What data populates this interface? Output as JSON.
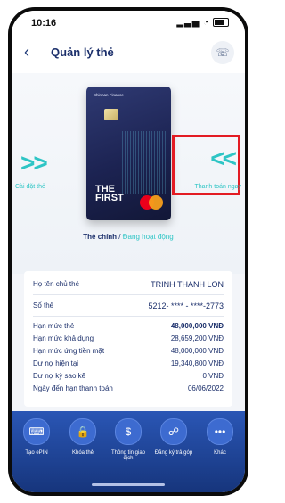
{
  "status_bar": {
    "time": "10:16",
    "signal": "..ll",
    "wifi": "wifi"
  },
  "header": {
    "back_icon": "chevron-left-icon",
    "title": "Quản lý thẻ",
    "support_icon": "phone-icon"
  },
  "carousel": {
    "left_label": "Cài đặt thẻ",
    "right_label": "Thanh toán ngay",
    "card": {
      "brand": "Shinhan Finance",
      "name_line1": "THE",
      "name_line2": "FIRST",
      "network": "mastercard"
    },
    "card_type": "Thẻ chính",
    "separator": "/",
    "card_state": "Đang hoạt động"
  },
  "info": {
    "rows": [
      {
        "label": "Họ tên chủ thẻ",
        "value": "TRINH THANH LON"
      },
      {
        "label": "Số thẻ",
        "value": "5212- **** - ****-2773"
      },
      {
        "label": "Hạn mức thẻ",
        "value": "48,000,000 VNĐ"
      },
      {
        "label": "Hạn mức khả dụng",
        "value": "28,659,200 VNĐ"
      },
      {
        "label": "Hạn mức ứng tiền mặt",
        "value": "48,000,000 VNĐ"
      },
      {
        "label": "Dư nợ hiện tại",
        "value": "19,340,800 VNĐ"
      },
      {
        "label": "Dư nợ kỳ sao kê",
        "value": "0 VNĐ"
      },
      {
        "label": "Ngày đến hạn thanh toán",
        "value": "06/06/2022"
      }
    ]
  },
  "actions": [
    {
      "label": "Tạo ePIN",
      "icon": "pin-keyboard-icon"
    },
    {
      "label": "Khóa thẻ",
      "icon": "lock-icon"
    },
    {
      "label": "Thông tin giao dịch",
      "icon": "money-icon"
    },
    {
      "label": "Đăng ký trả góp",
      "icon": "installment-icon"
    },
    {
      "label": "Khác",
      "icon": "more-icon"
    }
  ],
  "colors": {
    "accent": "#2ec5c5",
    "navy": "#1b2f6b",
    "highlight": "#e31b23",
    "action_bar": "#1f47a0"
  }
}
